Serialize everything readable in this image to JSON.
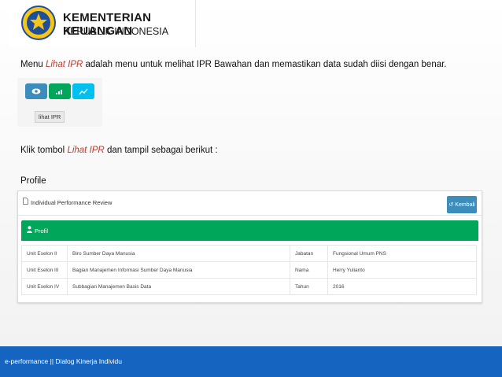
{
  "header": {
    "title": "KEMENTERIAN KEUANGAN",
    "subtitle": "REPUBLIK INDONESIA"
  },
  "intro": {
    "prefix": "Menu ",
    "highlight": "Lihat IPR",
    "suffix": "  adalah menu untuk melihat IPR Bawahan dan memastikan data sudah diisi dengan benar."
  },
  "button_crop": {
    "buttons": [
      {
        "icon": "eye-icon",
        "color": "#3c8dbc"
      },
      {
        "icon": "signal-bars-icon",
        "color": "#00a65a"
      },
      {
        "icon": "line-chart-icon",
        "color": "#00c0ef"
      }
    ],
    "tooltip": "lihat IPR"
  },
  "instruction": {
    "prefix": "Klik tombol ",
    "highlight": "Lihat IPR",
    "suffix": " dan tampil sebagai berikut :"
  },
  "section_label": "Profile",
  "screenshot": {
    "title": "Individual Performance Review",
    "back_button": "Kembali",
    "panel_title": "Profil",
    "rows": [
      {
        "label": "Unit Eselon II",
        "value": "Biro Sumber Daya Manusia",
        "label2": "Jabatan",
        "value2": "Fungsional Umum PNS"
      },
      {
        "label": "Unit Eselon III",
        "value": "Bagian Manajemen Informasi Sumber Daya Manusia",
        "label2": "Nama",
        "value2": "Herry Yulianto"
      },
      {
        "label": "Unit Eselon IV",
        "value": "Subbagian Manajemen Basis Data",
        "label2": "Tahun",
        "value2": "2016"
      }
    ]
  },
  "footer": {
    "text": "e-performance || Dialog Kinerja Individu"
  },
  "colors": {
    "footer": "#1565c0",
    "panel_green": "#00a65a",
    "highlight_text": "#c0392b"
  }
}
